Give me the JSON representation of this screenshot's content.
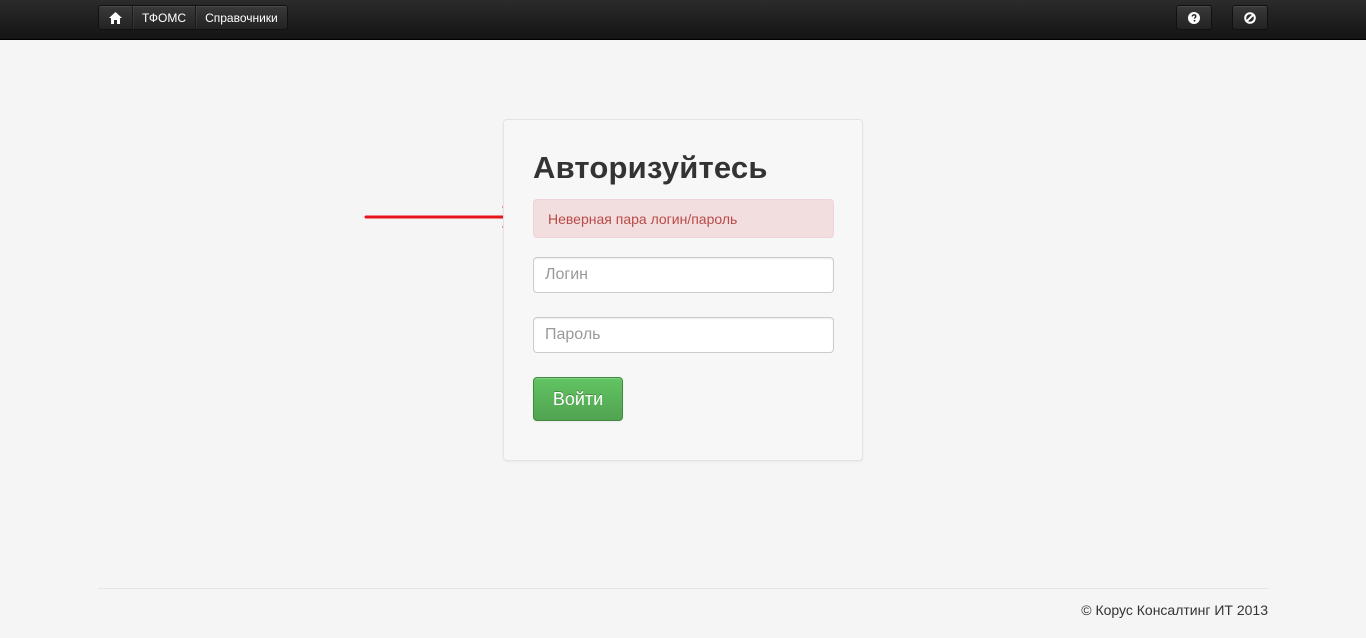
{
  "navbar": {
    "items": [
      {
        "icon": "home-icon"
      },
      {
        "label": "ТФОМС"
      },
      {
        "label": "Справочники"
      }
    ],
    "right_buttons": [
      {
        "icon": "help-icon"
      },
      {
        "icon": "logout-icon"
      }
    ]
  },
  "login": {
    "title": "Авторизуйтесь",
    "error": "Неверная пара логин/пароль",
    "login_placeholder": "Логин",
    "password_placeholder": "Пароль",
    "submit_label": "Войти"
  },
  "footer": {
    "copyright": "© Корус Консалтинг ИТ 2013"
  },
  "colors": {
    "error_bg": "#f2dede",
    "error_text": "#b94a48",
    "submit_green": "#5bb75b",
    "arrow_red": "#e8151b"
  }
}
